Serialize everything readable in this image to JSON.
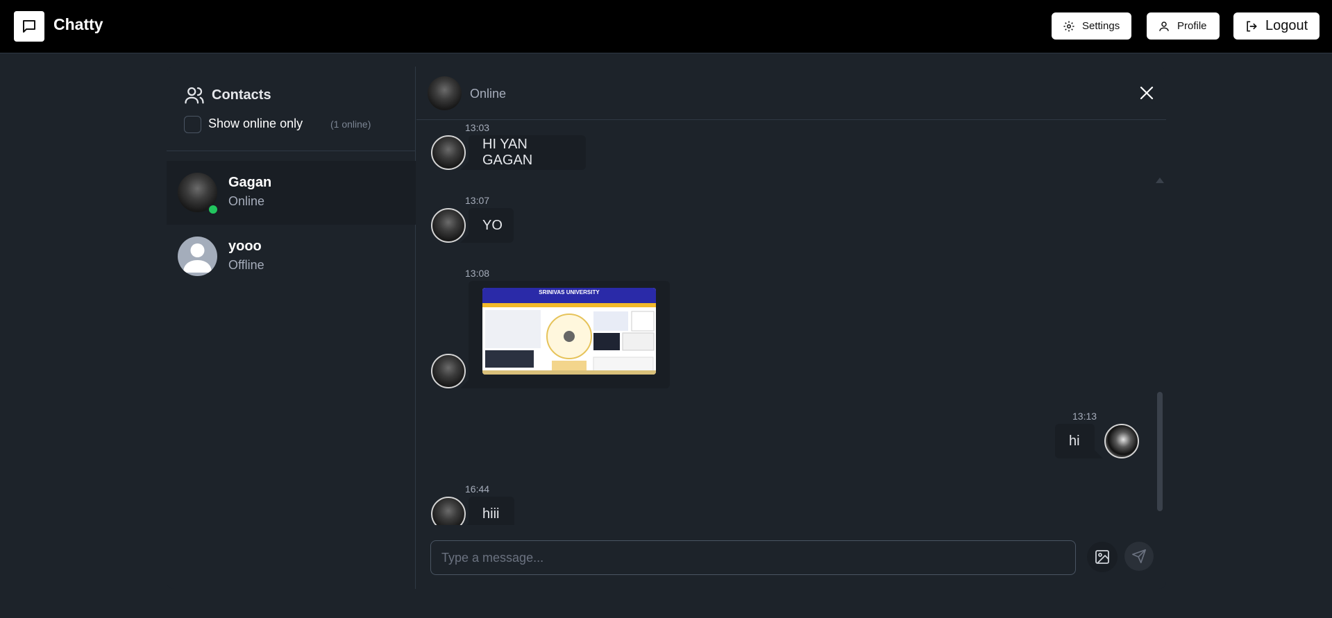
{
  "app": {
    "title": "Chatty"
  },
  "header": {
    "settings_label": "Settings",
    "profile_label": "Profile",
    "logout_label": "Logout"
  },
  "sidebar": {
    "title": "Contacts",
    "show_online_label": "Show online only",
    "online_count": "(1 online)",
    "contacts": [
      {
        "name": "Gagan",
        "status": "Online"
      },
      {
        "name": "yooo",
        "status": "Offline"
      }
    ]
  },
  "chat": {
    "header_status": "Online",
    "messages": [
      {
        "time": "13:03",
        "text": "HI YAN GAGAN",
        "side": "left"
      },
      {
        "time": "13:07",
        "text": "YO",
        "side": "left"
      },
      {
        "time": "13:08",
        "text": "",
        "side": "left",
        "image_title": "SRINIVAS UNIVERSITY"
      },
      {
        "time": "13:13",
        "text": "hi",
        "side": "right"
      },
      {
        "time": "16:44",
        "text": "hiii",
        "side": "left"
      }
    ],
    "composer_placeholder": "Type a message..."
  },
  "colors": {
    "topbar": "#000000",
    "background": "#1d232a",
    "bubble": "#191e24",
    "online_dot": "#22c55e"
  }
}
